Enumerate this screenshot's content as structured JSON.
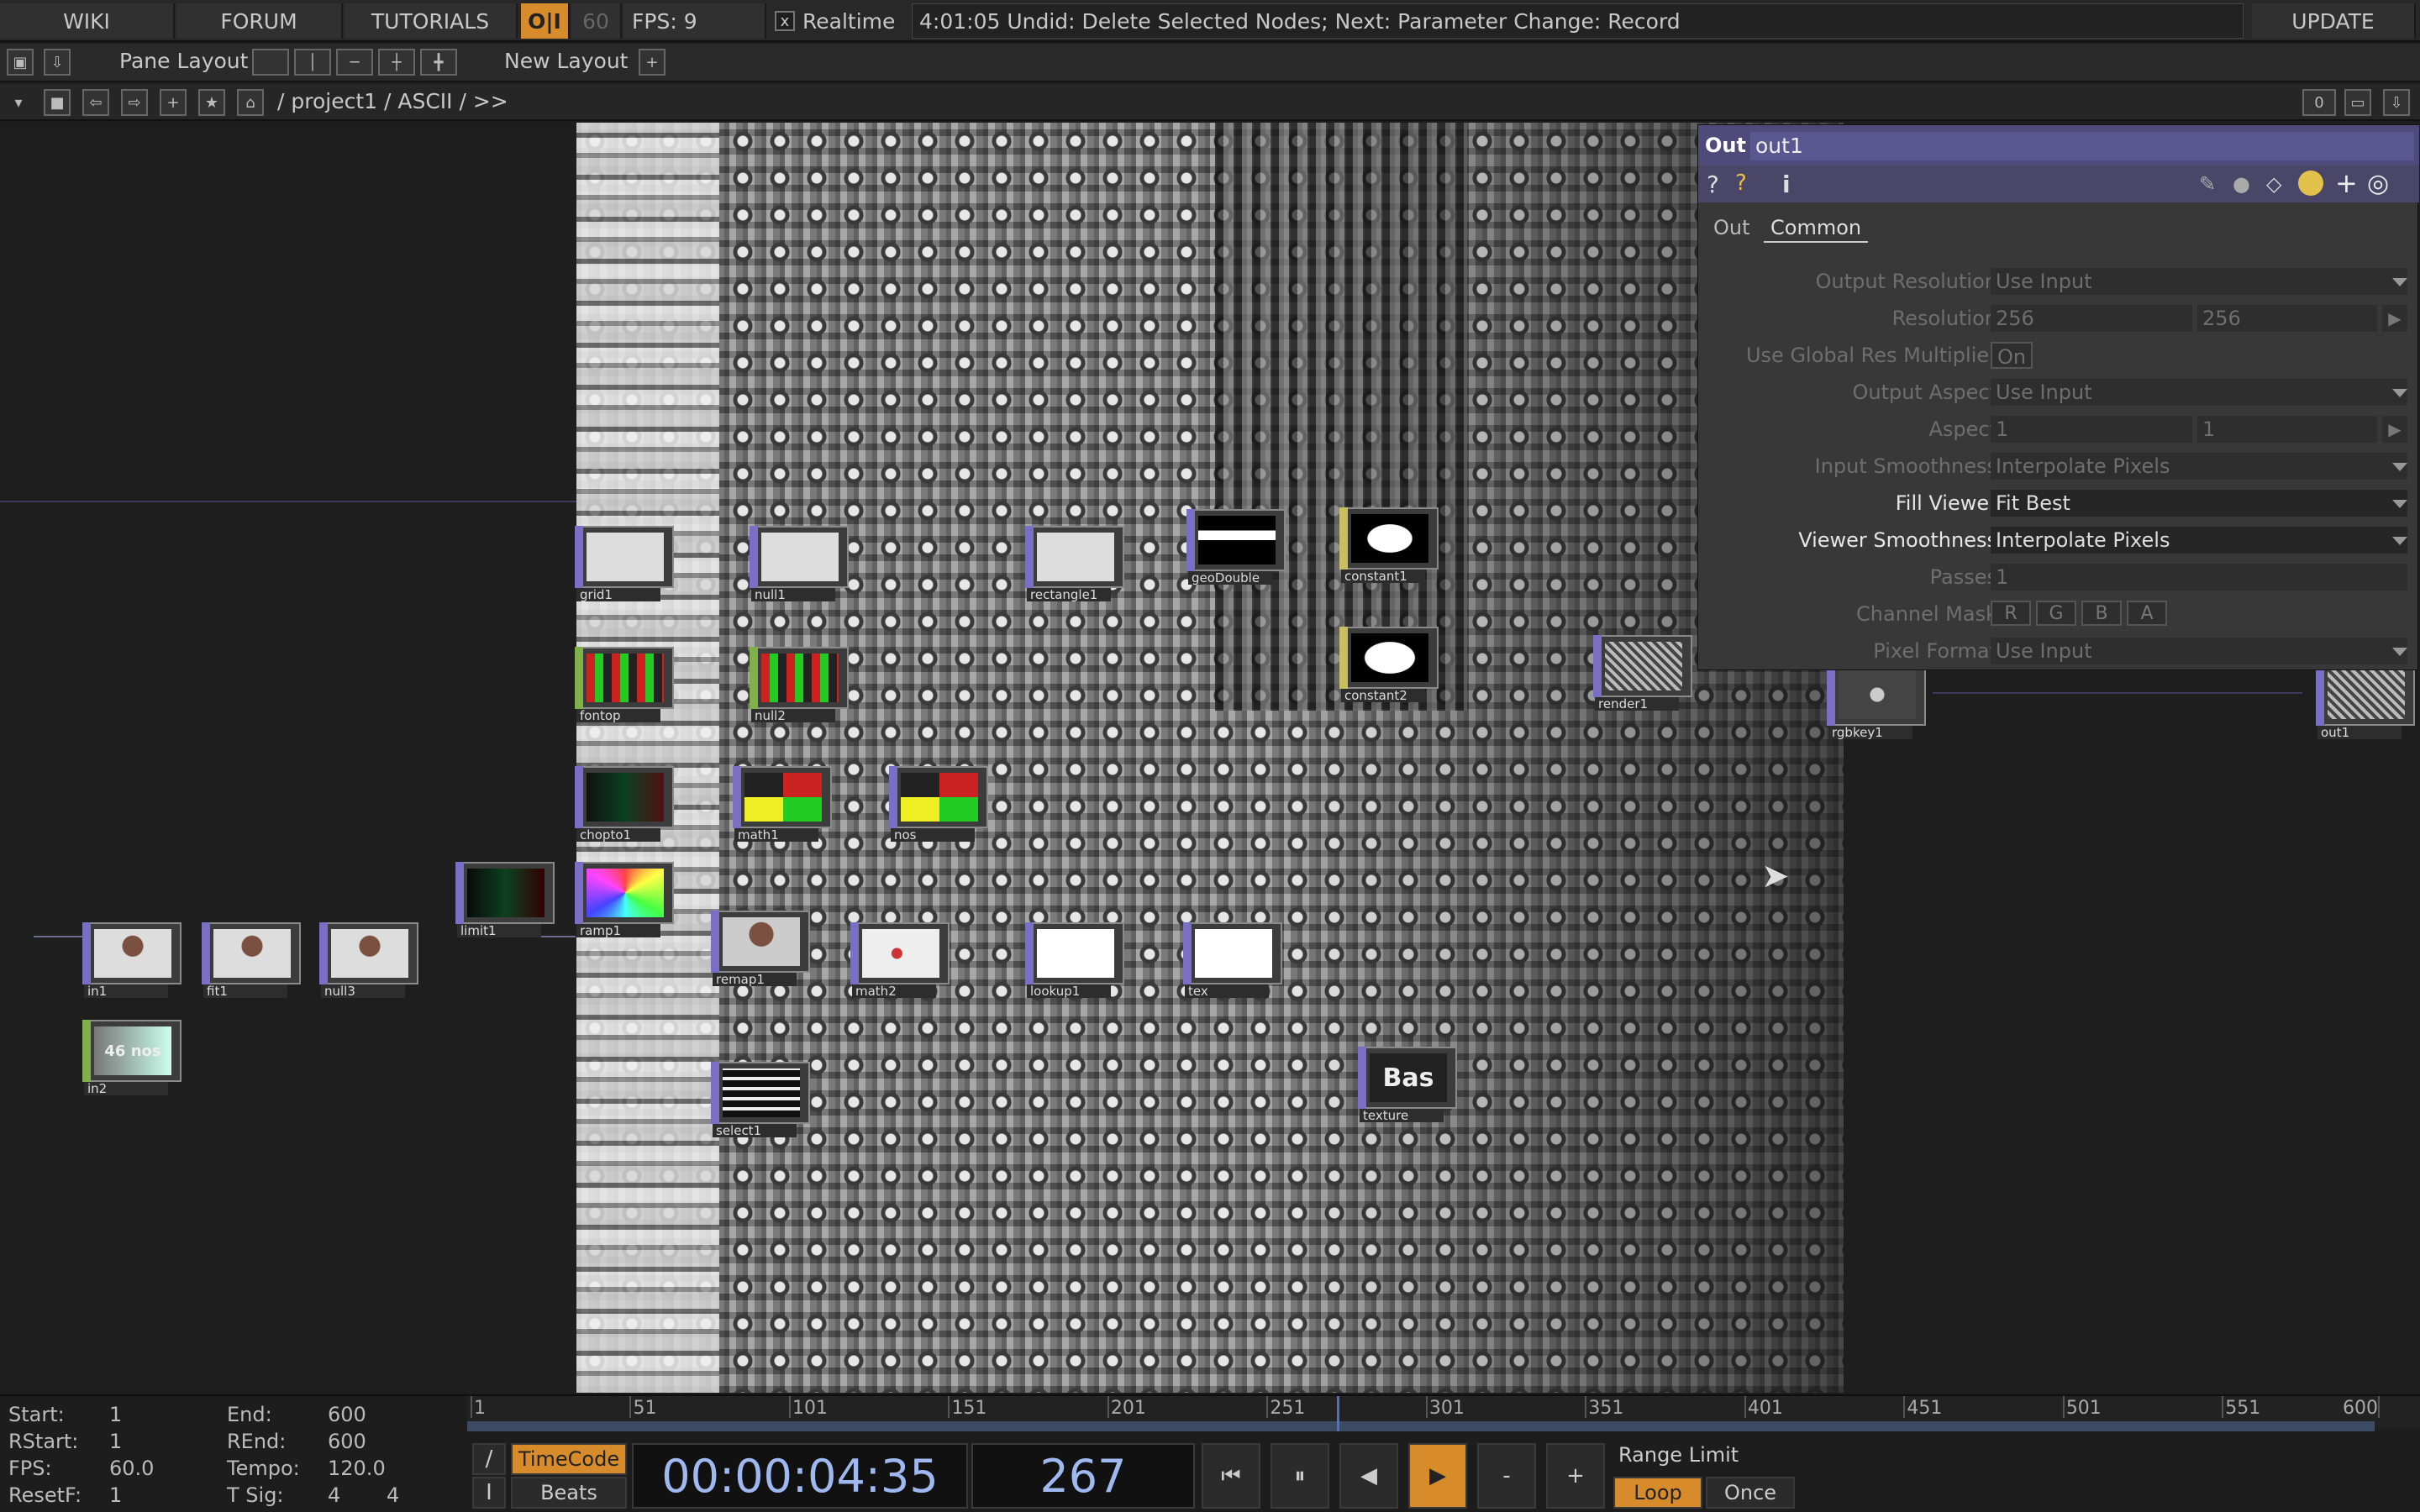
{
  "topbar": {
    "wiki": "WIKI",
    "forum": "FORUM",
    "tutorials": "TUTORIALS",
    "oi": "O|I",
    "fps_target": "60",
    "fps": "FPS:  9",
    "realtime_check": "x",
    "realtime": "Realtime",
    "status": "4:01:05 Undid: Delete Selected Nodes; Next: Parameter Change: Record",
    "update": "UPDATE"
  },
  "layoutbar": {
    "pane_layout": "Pane Layout",
    "new_layout": "New Layout",
    "plus": "+"
  },
  "pathbar": {
    "path": "/ project1 / ASCII / >>",
    "counter": "0"
  },
  "nodes": [
    {
      "name": "in1"
    },
    {
      "name": "fit1"
    },
    {
      "name": "null3"
    },
    {
      "name": "in2",
      "thumb_text": "46 nos"
    },
    {
      "name": "limit1"
    },
    {
      "name": "grid1"
    },
    {
      "name": "null1"
    },
    {
      "name": "rectangle1"
    },
    {
      "name": "geoDouble"
    },
    {
      "name": "constant1"
    },
    {
      "name": "constant2"
    },
    {
      "name": "fontop"
    },
    {
      "name": "null2"
    },
    {
      "name": "chopto1"
    },
    {
      "name": "math1"
    },
    {
      "name": "nos"
    },
    {
      "name": "ramp1"
    },
    {
      "name": "remap1"
    },
    {
      "name": "math2"
    },
    {
      "name": "lookup1"
    },
    {
      "name": "tex"
    },
    {
      "name": "select1"
    },
    {
      "name": "render1"
    },
    {
      "name": "rgbkey1"
    },
    {
      "name": "out1"
    },
    {
      "name": "texture",
      "thumb_text": "Bas"
    }
  ],
  "panel": {
    "type": "Out",
    "name": "out1",
    "tabs": [
      "Out",
      "Common"
    ],
    "params": [
      {
        "label": "Output Resolution",
        "value": "Use Input",
        "state": "dim"
      },
      {
        "label": "Resolution",
        "value": "256",
        "value2": "256",
        "state": "dim"
      },
      {
        "label": "Use Global Res Multiplier",
        "value": "On",
        "state": "dim"
      },
      {
        "label": "Output Aspect",
        "value": "Use Input",
        "state": "dim"
      },
      {
        "label": "Aspect",
        "value": "1",
        "value2": "1",
        "state": "dim"
      },
      {
        "label": "Input Smoothness",
        "value": "Interpolate Pixels",
        "state": "dim"
      },
      {
        "label": "Fill Viewer",
        "value": "Fit Best",
        "state": "act"
      },
      {
        "label": "Viewer Smoothness",
        "value": "Interpolate Pixels",
        "state": "act"
      },
      {
        "label": "Passes",
        "value": "1",
        "state": "dim"
      },
      {
        "label": "Channel Mask",
        "value": "R G B A",
        "state": "dim"
      },
      {
        "label": "Pixel Format",
        "value": "Use Input",
        "state": "dim"
      }
    ],
    "channel_mask": [
      "R",
      "G",
      "B",
      "A"
    ]
  },
  "timeline": {
    "ruler": [
      "1",
      "51",
      "101",
      "151",
      "201",
      "251",
      "301",
      "351",
      "401",
      "451",
      "501",
      "551",
      "600"
    ],
    "start_label": "Start:",
    "start": "1",
    "end_label": "End:",
    "end": "600",
    "rstart_label": "RStart:",
    "rstart": "1",
    "rend_label": "REnd:",
    "rend": "600",
    "fps_label": "FPS:",
    "fps": "60.0",
    "tempo_label": "Tempo:",
    "tempo": "120.0",
    "resetf_label": "ResetF:",
    "resetf": "1",
    "tsig_label": "T Sig:",
    "tsig_a": "4",
    "tsig_b": "4",
    "timecode": "TimeCode",
    "beats": "Beats",
    "time": "00:00:04:35",
    "frame": "267",
    "range_limit": "Range Limit",
    "loop": "Loop",
    "once": "Once",
    "minus": "-",
    "plus": "+",
    "toggle_slash": "/",
    "toggle_i": "I"
  }
}
